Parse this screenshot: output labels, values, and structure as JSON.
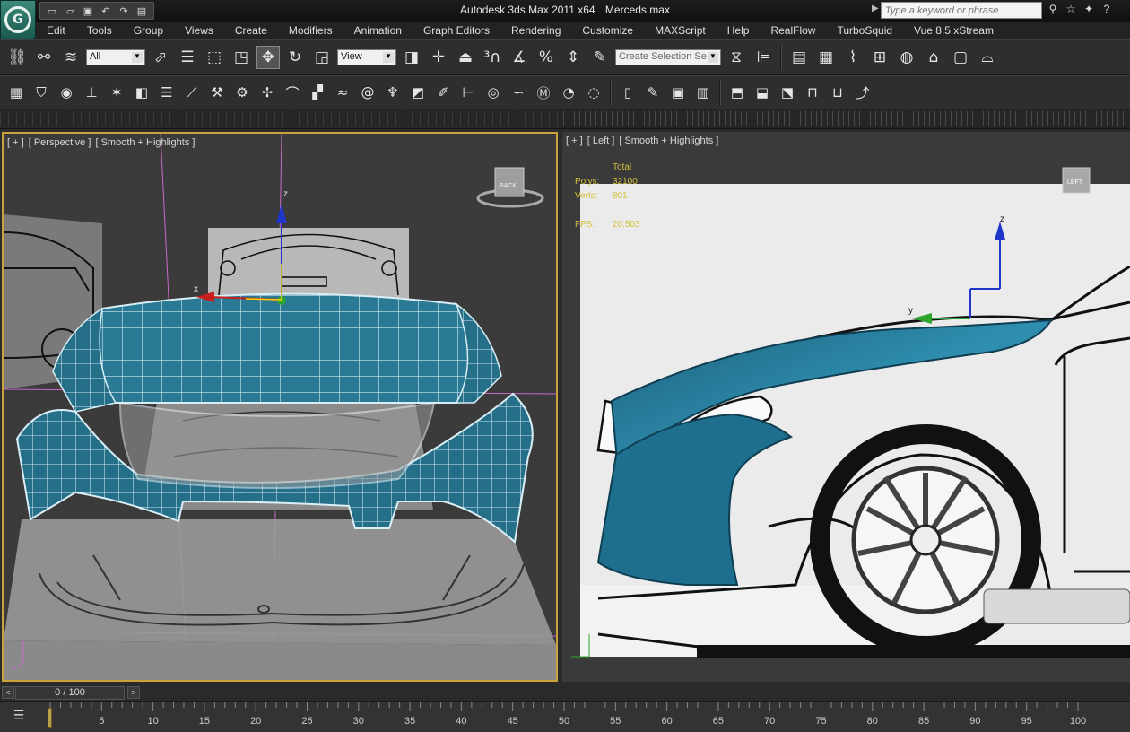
{
  "app": {
    "title": "Autodesk 3ds Max  2011 x64",
    "file": "Merceds.max",
    "logo_icon": "max-logo-icon",
    "search_placeholder": "Type a keyword or phrase"
  },
  "quick_access": [
    "new-file-icon",
    "open-folder-icon",
    "save-icon",
    "undo-icon",
    "redo-icon",
    "project-folder-icon"
  ],
  "title_right_icons": [
    "binoculars-icon",
    "star-icon",
    "tools-icon",
    "help-icon"
  ],
  "menu": [
    "Edit",
    "Tools",
    "Group",
    "Views",
    "Create",
    "Modifiers",
    "Animation",
    "Graph Editors",
    "Rendering",
    "Customize",
    "MAXScript",
    "Help",
    "RealFlow",
    "TurboSquid",
    "Vue 8.5 xStream"
  ],
  "toolbar": {
    "selection_filter": "All",
    "ref_coord": "View",
    "named_selection_placeholder": "Create Selection Se",
    "active_tool": "select-and-move"
  },
  "viewports": {
    "perspective": {
      "label": [
        "[ + ]",
        "[ Perspective ]",
        "[ Smooth + Highlights ]"
      ],
      "viewcube_face": "BACK",
      "axis_x": "x",
      "axis_z": "z"
    },
    "left": {
      "label": [
        "[ + ]",
        "[ Left ]",
        "[ Smooth + Highlights ]"
      ],
      "viewcube_face": "LEFT",
      "stats_header": "Total",
      "stats": [
        {
          "key": "Polys:",
          "value": "32100"
        },
        {
          "key": "Verts:",
          "value": "801"
        },
        {
          "key": "FPS:",
          "value": "20.503"
        }
      ],
      "axis_y": "y",
      "axis_z": "z"
    }
  },
  "timeline": {
    "frame_display": "0 / 100",
    "current_frame": 0,
    "ticks": [
      5,
      10,
      15,
      20,
      25,
      30,
      35,
      40,
      45,
      50,
      55,
      60,
      65,
      70,
      75,
      80,
      85,
      90,
      95,
      100
    ]
  },
  "colors": {
    "mesh": "#2a7a95",
    "mesh_light": "#3fa3c2",
    "active_border": "#c9a23a",
    "stats_text": "#d4c13a",
    "grid_pink": "#c86ac8"
  }
}
